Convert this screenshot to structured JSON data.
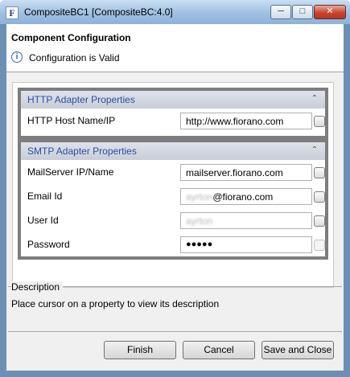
{
  "window": {
    "title": "CompositeBC1 [CompositeBC:4.0]",
    "app_icon_letter": "F"
  },
  "controls": {
    "minimize": "─",
    "maximize": "□",
    "close": "✕"
  },
  "header": {
    "title": "Component Configuration",
    "status_message": "Configuration is Valid",
    "info_icon": "i"
  },
  "http_section": {
    "title": "HTTP Adapter Properties",
    "rows": [
      {
        "label": "HTTP Host Name/IP",
        "value": "http://www.fiorano.com"
      }
    ]
  },
  "smtp_section": {
    "title": "SMTP Adapter Properties",
    "rows": [
      {
        "label": "MailServer IP/Name",
        "value": "mailserver.fiorano.com"
      },
      {
        "label": "Email Id",
        "value_prefix": "ayrton",
        "value": "@fiorano.com"
      },
      {
        "label": "User Id",
        "value": "ayrton"
      },
      {
        "label": "Password",
        "value": "●●●●●"
      }
    ]
  },
  "collapse_glyph": "⌃",
  "description": {
    "title": "Description",
    "text": "Place cursor on a property to view its description"
  },
  "buttons": {
    "finish": "Finish",
    "cancel": "Cancel",
    "save_close": "Save and Close"
  }
}
